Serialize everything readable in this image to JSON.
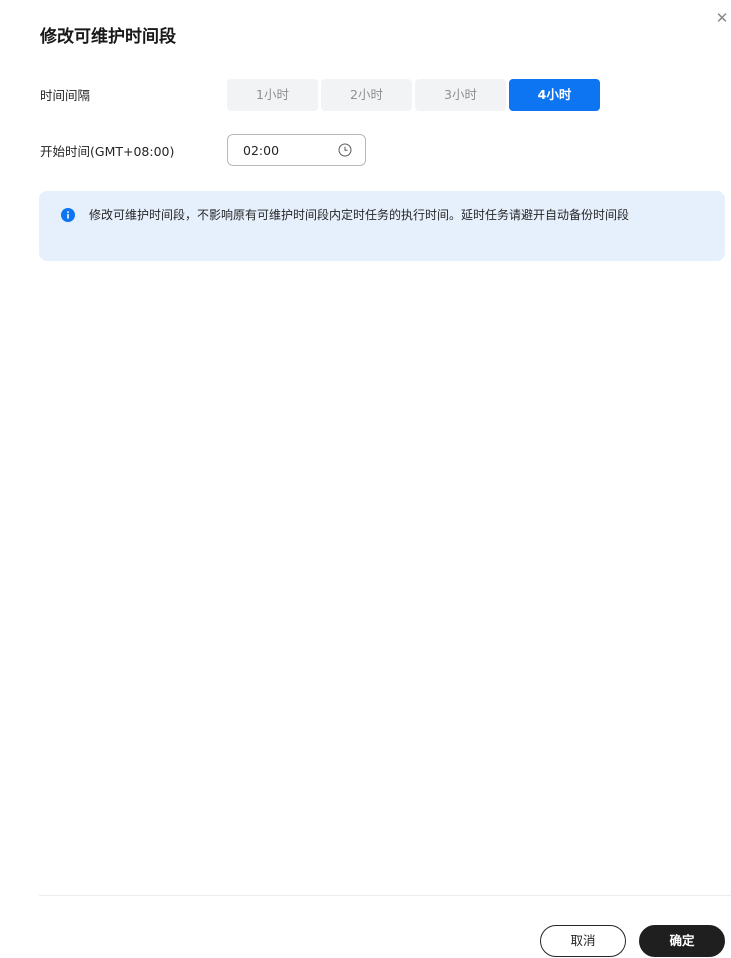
{
  "dialog": {
    "title": "修改可维护时间段",
    "close_icon": "close-icon"
  },
  "form": {
    "interval_label": "时间间隔",
    "interval_options": [
      "1小时",
      "2小时",
      "3小时",
      "4小时"
    ],
    "interval_selected": "4小时",
    "start_label": "开始时间(GMT+08:00)",
    "start_value": "02:00",
    "start_icon": "clock-icon"
  },
  "notice": {
    "icon": "info-icon",
    "text": "修改可维护时间段，不影响原有可维护时间段内定时任务的执行时间。延时任务请避开自动备份时间段"
  },
  "footer": {
    "cancel_label": "取消",
    "ok_label": "确定"
  },
  "colors": {
    "accent": "#0d74f2",
    "notice_bg": "#e6f0fd",
    "primary_button": "#1f1f1f"
  }
}
